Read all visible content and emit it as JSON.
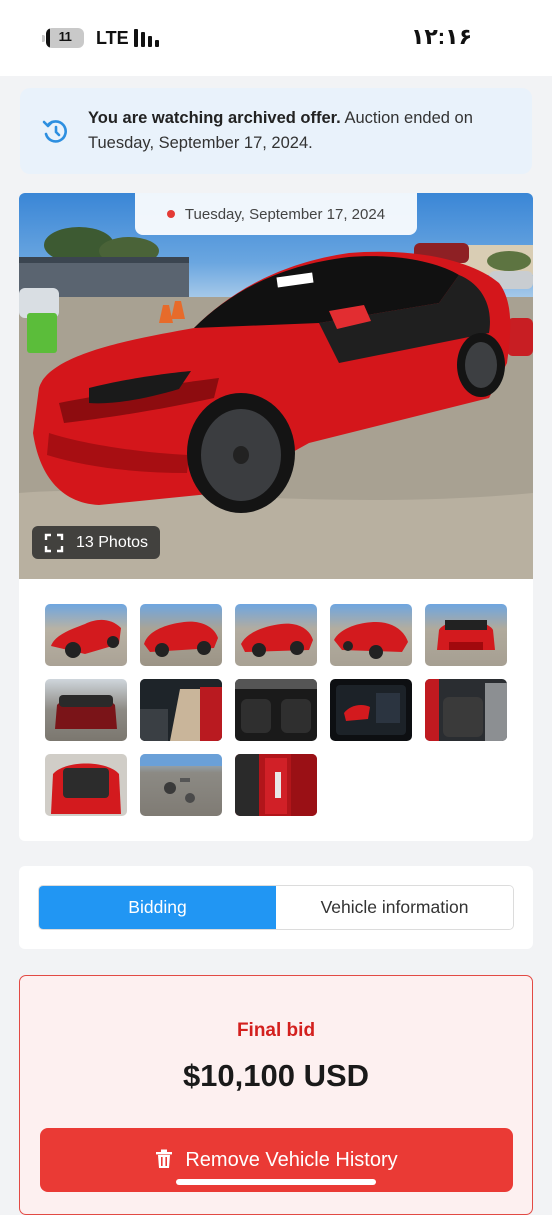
{
  "status_bar": {
    "battery_level": "11",
    "network": "LTE",
    "time": "۱۲:۱۶"
  },
  "notice": {
    "icon": "history-icon",
    "bold_text": "You are watching archived offer.",
    "text": " Auction ended on Tuesday, September 17, 2024."
  },
  "gallery": {
    "date_label": "Tuesday, September 17, 2024",
    "photos_label": "13 Photos",
    "thumbnail_count": 13
  },
  "tabs": [
    {
      "label": "Bidding",
      "active": true
    },
    {
      "label": "Vehicle information",
      "active": false
    }
  ],
  "bid": {
    "label": "Final bid",
    "value": "$10,100 USD",
    "action_label": "Remove Vehicle History",
    "action_icon": "trash-icon"
  },
  "colors": {
    "accent": "#2196f3",
    "danger": "#ea3a35",
    "car_red": "#d4161b"
  }
}
